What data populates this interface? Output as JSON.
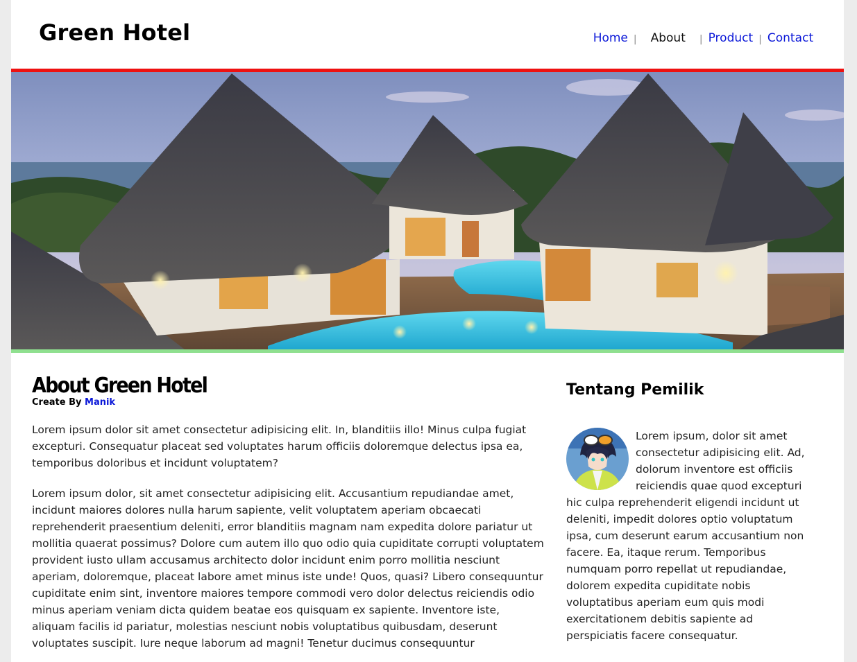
{
  "header": {
    "site_title": "Green Hotel",
    "nav": [
      {
        "label": "Home"
      },
      {
        "label": "About"
      },
      {
        "label": "Product"
      },
      {
        "label": "Contact"
      }
    ],
    "nav_separator": "|"
  },
  "colors": {
    "top_border": "#ee1111",
    "bottom_border": "#8fe08f",
    "link": "#0b18d8"
  },
  "hero": {
    "image": "hotel-villas-photo"
  },
  "main": {
    "title": "About Green Hotel",
    "byline_prefix": "Create By",
    "byline_author": "Manik",
    "paragraphs": [
      "Lorem ipsum dolor sit amet consectetur adipisicing elit. In, blanditiis illo! Minus culpa fugiat excepturi. Consequatur placeat sed voluptates harum officiis doloremque delectus ipsa ea, temporibus doloribus et incidunt voluptatem?",
      "Lorem ipsum dolor, sit amet consectetur adipisicing elit. Accusantium repudiandae amet, incidunt maiores dolores nulla harum sapiente, velit voluptatem aperiam obcaecati reprehenderit praesentium deleniti, error blanditiis magnam nam expedita dolore pariatur ut mollitia quaerat possimus? Dolore cum autem illo quo odio quia cupiditate corrupti voluptatem provident iusto ullam accusamus architecto dolor incidunt enim porro mollitia nesciunt aperiam, doloremque, placeat labore amet minus iste unde! Quos, quasi? Libero consequuntur cupiditate enim sint, inventore maiores tempore commodi vero dolor delectus reiciendis odio minus aperiam veniam dicta quidem beatae eos quisquam ex sapiente. Inventore iste, aliquam facilis id pariatur, molestias nesciunt nobis voluptatibus quibusdam, deserunt voluptates suscipit. Iure neque laborum ad magni! Tenetur ducimus consequuntur"
    ]
  },
  "sidebar": {
    "title": "Tentang Pemilik",
    "avatar": "owner-avatar",
    "text": "Lorem ipsum, dolor sit amet consectetur adipisicing elit. Ad, dolorum inventore est officiis reiciendis quae quod excepturi hic culpa reprehenderit eligendi incidunt ut deleniti, impedit dolores optio voluptatum ipsa, cum deserunt earum accusantium non facere. Ea, itaque rerum. Temporibus numquam porro repellat ut repudiandae, dolorem expedita cupiditate nobis voluptatibus aperiam eum quis modi exercitationem debitis sapiente ad perspiciatis facere consequatur."
  }
}
